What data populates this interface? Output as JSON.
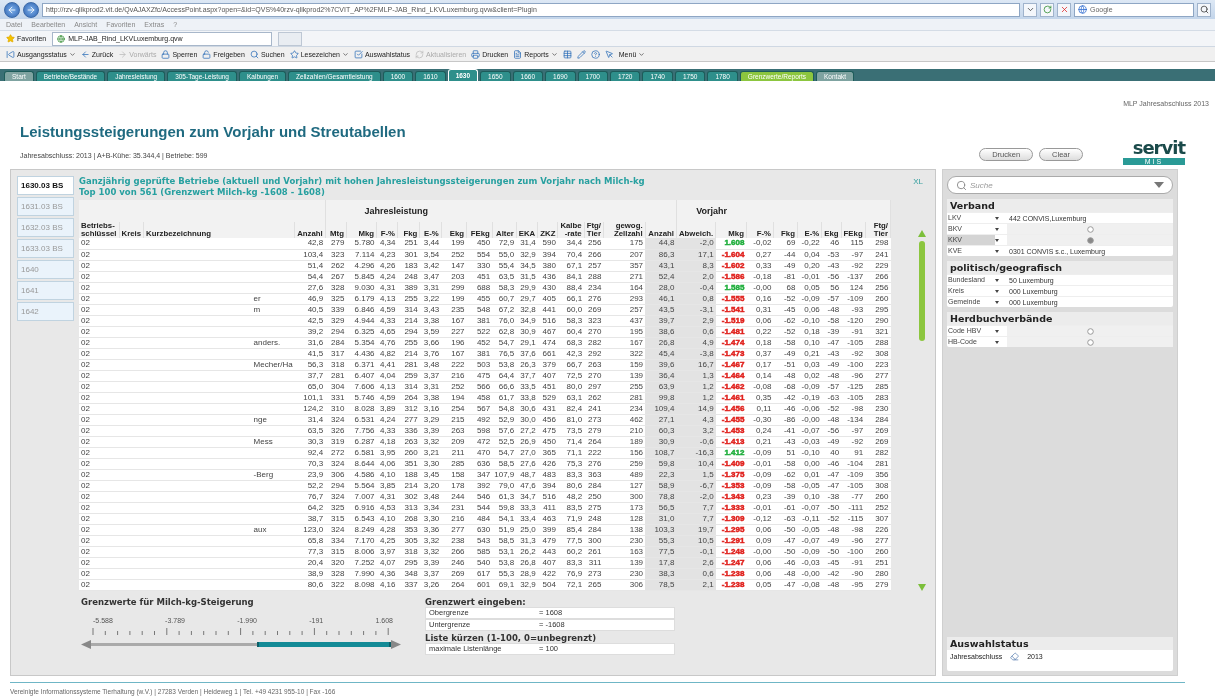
{
  "browser": {
    "url": "http://rzv-qlikprod2.vit.de/QvAJAXZfc/AccessPoint.aspx?open=&id=QVS%40rzv-qlikprod2%7CVIT_AP%2FMLP-JAB_Rind_LKVLuxemburg.qvw&client=Plugin",
    "search": {
      "placeholder": "Google"
    }
  },
  "menu": [
    "Datei",
    "Bearbeiten",
    "Ansicht",
    "Favoriten",
    "Extras",
    "?"
  ],
  "favorites": {
    "label": "Favoriten",
    "tab": "MLP-JAB_Rind_LKVLuxemburg.qvw"
  },
  "toolbar": [
    {
      "kind": "status",
      "label": "Ausgangsstatus",
      "dropdown": true,
      "disabled": false
    },
    {
      "kind": "back",
      "label": "Zurück",
      "dropdown": false,
      "disabled": false
    },
    {
      "kind": "forward",
      "label": "Vorwärts",
      "dropdown": false,
      "disabled": true
    },
    {
      "kind": "lock",
      "label": "Sperren",
      "dropdown": false,
      "disabled": false
    },
    {
      "kind": "unlock",
      "label": "Freigeben",
      "dropdown": false,
      "disabled": false
    },
    {
      "kind": "search",
      "label": "Suchen",
      "dropdown": false,
      "disabled": false
    },
    {
      "kind": "bookmark",
      "label": "Lesezeichen",
      "dropdown": true,
      "disabled": false
    },
    {
      "kind": "selection",
      "label": "Auswahlstatus",
      "dropdown": false,
      "disabled": false
    },
    {
      "kind": "refresh",
      "label": "Aktualisieren",
      "dropdown": false,
      "disabled": true
    },
    {
      "kind": "print",
      "label": "Drucken",
      "dropdown": false,
      "disabled": false
    },
    {
      "kind": "report",
      "label": "Reports",
      "dropdown": true,
      "disabled": false
    },
    {
      "kind": "table",
      "dropdown": false,
      "disabled": false
    },
    {
      "kind": "edit",
      "dropdown": false,
      "disabled": false
    },
    {
      "kind": "help",
      "dropdown": false,
      "disabled": false
    },
    {
      "kind": "pointer",
      "dropdown": false,
      "disabled": false
    },
    {
      "kind": "text",
      "label": "Menü",
      "dropdown": true,
      "disabled": false
    }
  ],
  "sheet_tabs": [
    {
      "label": "Start",
      "selected": false,
      "color": "#7fa3a1"
    },
    {
      "label": "Betriebe/Bestände",
      "selected": false,
      "color": "#2e8f8b"
    },
    {
      "label": "Jahresleistung",
      "selected": false,
      "color": "#2e8f8b"
    },
    {
      "label": "305-Tage-Leistung",
      "selected": false,
      "color": "#2e8f8b"
    },
    {
      "label": "Kalbungen",
      "selected": false,
      "color": "#2e8f8b"
    },
    {
      "label": "Zellzahlen/Gesamtleistung",
      "selected": false,
      "color": "#2e8f8b"
    },
    {
      "label": "1600",
      "selected": false,
      "color": "#2e8f8b"
    },
    {
      "label": "1610",
      "selected": false,
      "color": "#2e8f8b"
    },
    {
      "label": "1630",
      "selected": true,
      "color": "#2e8f8b"
    },
    {
      "label": "1650",
      "selected": false,
      "color": "#2e8f8b"
    },
    {
      "label": "1660",
      "selected": false,
      "color": "#2e8f8b"
    },
    {
      "label": "1690",
      "selected": false,
      "color": "#2e8f8b"
    },
    {
      "label": "1700",
      "selected": false,
      "color": "#2e8f8b"
    },
    {
      "label": "1720",
      "selected": false,
      "color": "#2e8f8b"
    },
    {
      "label": "1740",
      "selected": false,
      "color": "#2e8f8b"
    },
    {
      "label": "1750",
      "selected": false,
      "color": "#2e8f8b"
    },
    {
      "label": "1780",
      "selected": false,
      "color": "#2e8f8b"
    },
    {
      "label": "Grenzwerte/Reports",
      "selected": false,
      "color": "#8cc63f"
    },
    {
      "label": "Kontakt",
      "selected": false,
      "color": "#7fa3a1"
    }
  ],
  "header": {
    "caption": "MLP Jahresabschluss 2013",
    "title": "Leistungssteigerungen zum Vorjahr und Streutabellen",
    "subtitle": "Jahresabschluss: 2013 | A+B-Kühe: 35.344,4 | Betriebe: 599",
    "buttons": [
      "Drucken",
      "Clear"
    ],
    "logo": {
      "name": "servit",
      "tag": "MIS"
    }
  },
  "report_tabs": [
    {
      "label": "1630.03 BS",
      "selected": true
    },
    {
      "label": "1631.03 BS",
      "selected": false
    },
    {
      "label": "1632.03 BS",
      "selected": false
    },
    {
      "label": "1633.03 BS",
      "selected": false
    },
    {
      "label": "1640",
      "selected": false
    },
    {
      "label": "1641",
      "selected": false
    },
    {
      "label": "1642",
      "selected": false
    }
  ],
  "report": {
    "title_lines": [
      "Ganzjährig geprüfte Betriebe (aktuell und Vorjahr) mit hohen Jahresleistungssteigerungen zum Vorjahr nach Milch-kg",
      "Top 100 von 561 (Grenzwert Milch-kg -1608 - 1608)"
    ],
    "export": "XL"
  },
  "table": {
    "group_headings": [
      "Jahresleistung",
      "Vorjahr"
    ],
    "columns": [
      "Betriebs-\nschlüssel",
      "Kreis",
      "Kurzbezeichnung",
      "Anzahl",
      "Mtg",
      "Mkg",
      "F-%",
      "Fkg",
      "E-%",
      "Ekg",
      "FEkg",
      "Alter",
      "EKA",
      "ZKZ",
      "Kalbe\n-rate",
      "Ftg/\nTier",
      "gewog.\nZellzahl",
      "Anzahl",
      "Abweich.",
      "Mkg",
      "F-%",
      "Fkg",
      "E-%",
      "Ekg",
      "FEkg",
      "Ftg/\nTier"
    ],
    "rows": [
      {
        "color": "#1fae3c",
        "cells": [
          "02",
          "",
          "",
          "42,8",
          "279",
          "5.780",
          "4,34",
          "251",
          "3,44",
          "199",
          "450",
          "72,9",
          "31,4",
          "590",
          "34,4",
          "256",
          "175",
          "44,8",
          "-2,0",
          "1.608",
          "-0,02",
          "69",
          "-0,22",
          "46",
          "115",
          "298"
        ]
      },
      {
        "color": "#e0201c",
        "cells": [
          "02",
          "",
          "",
          "103,4",
          "323",
          "7.114",
          "4,23",
          "301",
          "3,54",
          "252",
          "554",
          "55,0",
          "32,9",
          "394",
          "70,4",
          "266",
          "207",
          "86,3",
          "17,1",
          "-1.604",
          "0,27",
          "-44",
          "0,04",
          "-53",
          "-97",
          "241"
        ]
      },
      {
        "color": "#e0201c",
        "cells": [
          "02",
          "",
          "",
          "51,4",
          "262",
          "4.296",
          "4,26",
          "183",
          "3,42",
          "147",
          "330",
          "55,4",
          "34,5",
          "380",
          "67,1",
          "257",
          "357",
          "43,1",
          "8,3",
          "-1.602",
          "0,33",
          "-49",
          "0,20",
          "-43",
          "-92",
          "229"
        ]
      },
      {
        "color": "#e0201c",
        "cells": [
          "02",
          "",
          "",
          "54,4",
          "267",
          "5.845",
          "4,24",
          "248",
          "3,47",
          "203",
          "451",
          "63,5",
          "31,5",
          "436",
          "84,1",
          "288",
          "271",
          "52,4",
          "2,0",
          "-1.586",
          "-0,18",
          "-81",
          "-0,01",
          "-56",
          "-137",
          "266"
        ]
      },
      {
        "color": "#1fae3c",
        "cells": [
          "02",
          "",
          "",
          "27,6",
          "328",
          "9.030",
          "4,31",
          "389",
          "3,31",
          "299",
          "688",
          "58,3",
          "29,9",
          "430",
          "88,4",
          "234",
          "164",
          "28,0",
          "-0,4",
          "1.585",
          "-0,00",
          "68",
          "0,05",
          "56",
          "124",
          "256"
        ]
      },
      {
        "color": "#e0201c",
        "cells": [
          "02",
          "",
          "er",
          "46,9",
          "325",
          "6.179",
          "4,13",
          "255",
          "3,22",
          "199",
          "455",
          "60,7",
          "29,7",
          "405",
          "66,1",
          "276",
          "293",
          "46,1",
          "0,8",
          "-1.555",
          "0,16",
          "-52",
          "-0,09",
          "-57",
          "-109",
          "260"
        ]
      },
      {
        "color": "#e0201c",
        "cells": [
          "02",
          "",
          "m",
          "40,5",
          "339",
          "6.846",
          "4,59",
          "314",
          "3,43",
          "235",
          "548",
          "67,2",
          "32,8",
          "441",
          "60,0",
          "269",
          "257",
          "43,5",
          "-3,1",
          "-1.541",
          "0,31",
          "-45",
          "0,06",
          "-48",
          "-93",
          "295"
        ]
      },
      {
        "color": "#e0201c",
        "cells": [
          "02",
          "",
          "",
          "42,5",
          "329",
          "4.944",
          "4,33",
          "214",
          "3,38",
          "167",
          "381",
          "76,0",
          "34,9",
          "516",
          "58,3",
          "323",
          "437",
          "39,7",
          "2,9",
          "-1.519",
          "0,06",
          "-62",
          "-0,10",
          "-58",
          "-120",
          "290"
        ]
      },
      {
        "color": "#e0201c",
        "cells": [
          "02",
          "",
          "",
          "39,2",
          "294",
          "6.325",
          "4,65",
          "294",
          "3,59",
          "227",
          "522",
          "62,8",
          "30,9",
          "467",
          "60,4",
          "270",
          "195",
          "38,6",
          "0,6",
          "-1.481",
          "0,22",
          "-52",
          "0,18",
          "-39",
          "-91",
          "321"
        ]
      },
      {
        "color": "#e0201c",
        "cells": [
          "02",
          "",
          "anders.",
          "31,6",
          "284",
          "5.354",
          "4,76",
          "255",
          "3,66",
          "196",
          "452",
          "54,7",
          "29,1",
          "474",
          "68,3",
          "282",
          "167",
          "26,8",
          "4,9",
          "-1.474",
          "0,18",
          "-58",
          "0,10",
          "-47",
          "-105",
          "288"
        ]
      },
      {
        "color": "#e0201c",
        "cells": [
          "02",
          "",
          "",
          "41,5",
          "317",
          "4.436",
          "4,82",
          "214",
          "3,76",
          "167",
          "381",
          "76,5",
          "37,6",
          "661",
          "42,3",
          "292",
          "322",
          "45,4",
          "-3,8",
          "-1.473",
          "0,37",
          "-49",
          "0,21",
          "-43",
          "-92",
          "308"
        ]
      },
      {
        "color": "#e0201c",
        "cells": [
          "02",
          "",
          "Mecher/Ha",
          "56,3",
          "318",
          "6.371",
          "4,41",
          "281",
          "3,48",
          "222",
          "503",
          "53,8",
          "26,3",
          "379",
          "66,7",
          "263",
          "159",
          "39,6",
          "16,7",
          "-1.467",
          "0,17",
          "-51",
          "0,03",
          "-49",
          "-100",
          "223"
        ]
      },
      {
        "color": "#e0201c",
        "cells": [
          "02",
          "",
          "",
          "37,7",
          "281",
          "6.407",
          "4,04",
          "259",
          "3,37",
          "216",
          "475",
          "64,4",
          "37,7",
          "407",
          "72,5",
          "270",
          "139",
          "36,4",
          "1,3",
          "-1.464",
          "0,14",
          "-48",
          "0,02",
          "-48",
          "-96",
          "277"
        ]
      },
      {
        "color": "#e0201c",
        "cells": [
          "02",
          "",
          "",
          "65,0",
          "304",
          "7.606",
          "4,13",
          "314",
          "3,31",
          "252",
          "566",
          "66,6",
          "33,5",
          "451",
          "80,0",
          "297",
          "255",
          "63,9",
          "1,2",
          "-1.462",
          "-0,08",
          "-68",
          "-0,09",
          "-57",
          "-125",
          "285"
        ]
      },
      {
        "color": "#e0201c",
        "cells": [
          "02",
          "",
          "",
          "101,1",
          "331",
          "5.746",
          "4,59",
          "264",
          "3,38",
          "194",
          "458",
          "61,7",
          "33,8",
          "529",
          "63,1",
          "262",
          "281",
          "99,8",
          "1,2",
          "-1.461",
          "0,35",
          "-42",
          "-0,19",
          "-63",
          "-105",
          "283"
        ]
      },
      {
        "color": "#e0201c",
        "cells": [
          "02",
          "",
          "",
          "124,2",
          "310",
          "8.028",
          "3,89",
          "312",
          "3,16",
          "254",
          "567",
          "54,8",
          "30,6",
          "431",
          "82,4",
          "241",
          "234",
          "109,4",
          "14,9",
          "-1.456",
          "0,11",
          "-46",
          "-0,06",
          "-52",
          "-98",
          "230"
        ]
      },
      {
        "color": "#e0201c",
        "cells": [
          "02",
          "",
          "nge",
          "31,4",
          "324",
          "6.531",
          "4,24",
          "277",
          "3,29",
          "215",
          "492",
          "52,9",
          "30,0",
          "456",
          "81,0",
          "273",
          "462",
          "27,1",
          "4,3",
          "-1.455",
          "-0,30",
          "-86",
          "-0,00",
          "-48",
          "-134",
          "284"
        ]
      },
      {
        "color": "#e0201c",
        "cells": [
          "02",
          "",
          "",
          "63,5",
          "326",
          "7.756",
          "4,33",
          "336",
          "3,39",
          "263",
          "598",
          "57,6",
          "27,2",
          "475",
          "73,5",
          "279",
          "210",
          "60,3",
          "3,2",
          "-1.453",
          "0,24",
          "-41",
          "-0,07",
          "-56",
          "-97",
          "269"
        ]
      },
      {
        "color": "#e0201c",
        "cells": [
          "02",
          "",
          "Mess",
          "30,3",
          "319",
          "6.287",
          "4,18",
          "263",
          "3,32",
          "209",
          "472",
          "52,5",
          "26,9",
          "450",
          "71,4",
          "264",
          "189",
          "30,9",
          "-0,6",
          "-1.413",
          "0,21",
          "-43",
          "-0,03",
          "-49",
          "-92",
          "269"
        ]
      },
      {
        "color": "#1fae3c",
        "cells": [
          "02",
          "",
          "",
          "92,4",
          "272",
          "6.581",
          "3,95",
          "260",
          "3,21",
          "211",
          "470",
          "54,7",
          "27,0",
          "365",
          "71,1",
          "222",
          "156",
          "108,7",
          "-16,3",
          "1.412",
          "-0,09",
          "51",
          "-0,10",
          "40",
          "91",
          "282"
        ]
      },
      {
        "color": "#e0201c",
        "cells": [
          "02",
          "",
          "",
          "70,3",
          "324",
          "8.644",
          "4,06",
          "351",
          "3,30",
          "285",
          "636",
          "58,5",
          "27,6",
          "426",
          "75,3",
          "276",
          "259",
          "59,8",
          "10,4",
          "-1.409",
          "-0,01",
          "-58",
          "0,00",
          "-46",
          "-104",
          "281"
        ]
      },
      {
        "color": "#e0201c",
        "cells": [
          "02",
          "",
          "-Berg",
          "23,9",
          "306",
          "4.586",
          "4,10",
          "188",
          "3,45",
          "158",
          "347",
          "107,9",
          "48,7",
          "483",
          "83,3",
          "363",
          "489",
          "22,3",
          "1,5",
          "-1.375",
          "-0,09",
          "-62",
          "0,01",
          "-47",
          "-109",
          "356"
        ]
      },
      {
        "color": "#e0201c",
        "cells": [
          "02",
          "",
          "",
          "52,2",
          "294",
          "5.564",
          "3,85",
          "214",
          "3,20",
          "178",
          "392",
          "79,0",
          "47,6",
          "394",
          "80,6",
          "284",
          "127",
          "58,9",
          "-6,7",
          "-1.353",
          "-0,09",
          "-58",
          "-0,05",
          "-47",
          "-105",
          "308"
        ]
      },
      {
        "color": "#e0201c",
        "cells": [
          "02",
          "",
          "",
          "76,7",
          "324",
          "7.007",
          "4,31",
          "302",
          "3,48",
          "244",
          "546",
          "61,3",
          "34,7",
          "516",
          "48,2",
          "250",
          "300",
          "78,8",
          "-2,0",
          "-1.343",
          "0,23",
          "-39",
          "0,10",
          "-38",
          "-77",
          "260"
        ]
      },
      {
        "color": "#e0201c",
        "cells": [
          "02",
          "",
          "",
          "64,2",
          "325",
          "6.916",
          "4,53",
          "313",
          "3,34",
          "231",
          "544",
          "59,8",
          "33,3",
          "411",
          "83,5",
          "275",
          "173",
          "56,5",
          "7,7",
          "-1.333",
          "-0,01",
          "-61",
          "-0,07",
          "-50",
          "-111",
          "252"
        ]
      },
      {
        "color": "#e0201c",
        "cells": [
          "02",
          "",
          "",
          "38,7",
          "315",
          "6.543",
          "4,10",
          "268",
          "3,30",
          "216",
          "484",
          "54,1",
          "33,4",
          "463",
          "71,9",
          "248",
          "128",
          "31,0",
          "7,7",
          "-1.309",
          "-0,12",
          "-63",
          "-0,11",
          "-52",
          "-115",
          "307"
        ]
      },
      {
        "color": "#e0201c",
        "cells": [
          "02",
          "",
          "aux",
          "123,0",
          "324",
          "8.249",
          "4,28",
          "353",
          "3,36",
          "277",
          "630",
          "51,9",
          "25,0",
          "399",
          "85,4",
          "284",
          "138",
          "103,3",
          "19,7",
          "-1.295",
          "0,06",
          "-50",
          "-0,05",
          "-48",
          "-98",
          "226"
        ]
      },
      {
        "color": "#e0201c",
        "cells": [
          "02",
          "",
          "",
          "65,8",
          "334",
          "7.170",
          "4,25",
          "305",
          "3,32",
          "238",
          "543",
          "58,5",
          "31,3",
          "479",
          "77,5",
          "300",
          "230",
          "55,3",
          "10,5",
          "-1.291",
          "0,09",
          "-47",
          "-0,07",
          "-49",
          "-96",
          "277"
        ]
      },
      {
        "color": "#e0201c",
        "cells": [
          "02",
          "",
          "",
          "77,3",
          "315",
          "8.006",
          "3,97",
          "318",
          "3,32",
          "266",
          "585",
          "53,1",
          "26,2",
          "443",
          "60,2",
          "261",
          "163",
          "77,5",
          "-0,1",
          "-1.248",
          "-0,00",
          "-50",
          "-0,09",
          "-50",
          "-100",
          "260"
        ]
      },
      {
        "color": "#e0201c",
        "cells": [
          "02",
          "",
          "",
          "20,4",
          "320",
          "7.252",
          "4,07",
          "295",
          "3,39",
          "246",
          "540",
          "53,8",
          "26,8",
          "407",
          "83,3",
          "311",
          "139",
          "17,8",
          "2,6",
          "-1.247",
          "0,06",
          "-46",
          "-0,03",
          "-45",
          "-91",
          "251"
        ]
      },
      {
        "color": "#e0201c",
        "cells": [
          "02",
          "",
          "",
          "38,9",
          "328",
          "7.990",
          "4,36",
          "348",
          "3,37",
          "269",
          "617",
          "55,3",
          "28,9",
          "422",
          "76,9",
          "273",
          "230",
          "38,3",
          "0,6",
          "-1.238",
          "0,06",
          "-48",
          "-0,00",
          "-42",
          "-90",
          "280"
        ]
      },
      {
        "color": "#e0201c",
        "cells": [
          "02",
          "",
          "",
          "80,6",
          "322",
          "8.098",
          "4,16",
          "337",
          "3,26",
          "264",
          "601",
          "69,1",
          "32,9",
          "504",
          "72,1",
          "265",
          "306",
          "78,5",
          "2,1",
          "-1.238",
          "0,05",
          "-47",
          "-0,08",
          "-48",
          "-95",
          "279"
        ]
      }
    ]
  },
  "slider": {
    "title": "Grenzwerte für Milch-kg-Steigerung",
    "tick_labels": [
      "-5.588",
      "-3.789",
      "-1.990",
      "-191",
      "1.608"
    ]
  },
  "limits": {
    "title": "Grenzwert eingeben:",
    "fields": [
      {
        "label": "Obergrenze",
        "value": "= 1608"
      },
      {
        "label": "Untergrenze",
        "value": "= -1608"
      }
    ]
  },
  "list_limit": {
    "title": "Liste kürzen (1-100, 0=unbegrenzt)",
    "fields": [
      {
        "label": "maximale Listenlänge",
        "value": "= 100"
      }
    ]
  },
  "sidebar": {
    "search": {
      "placeholder": "Suche"
    },
    "groups": [
      {
        "title": "Verband",
        "items": [
          {
            "label": "LKV",
            "value": "442 CONVIS,Luxemburg",
            "selected": false
          },
          {
            "label": "BKV",
            "selected": false
          },
          {
            "label": "KKV",
            "selected": true
          },
          {
            "label": "KVE",
            "value": "0301 CONVIS s.c., Luxemburg",
            "selected": false
          }
        ]
      },
      {
        "title": "politisch/geografisch",
        "items": [
          {
            "label": "Bundesland",
            "value": "50 Luxemburg",
            "selected": false
          },
          {
            "label": "Kreis",
            "value": "000 Luxemburg",
            "selected": false
          },
          {
            "label": "Gemeinde",
            "value": "000 Luxemburg",
            "selected": false
          }
        ]
      },
      {
        "title": "Herdbuchverbände",
        "items": [
          {
            "label": "Code HBV",
            "selected": false
          },
          {
            "label": "HB-Code",
            "selected": false
          }
        ]
      }
    ],
    "status": {
      "title": "Auswahlstatus",
      "items": [
        {
          "label": "Jahresabschluss",
          "value": "2013"
        }
      ]
    }
  },
  "footer": "Vereinigte Informationssysteme Tierhaltung (w.V.) | 27283 Verden | Heideweg 1 | Tel. +49 4231 955-10 | Fax -166"
}
